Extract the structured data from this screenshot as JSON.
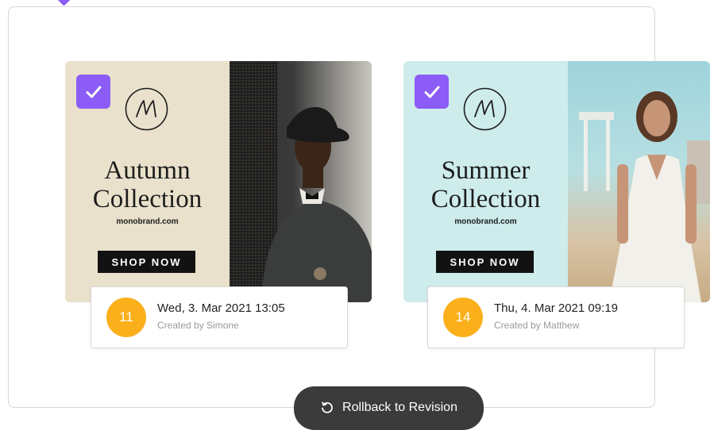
{
  "cards": [
    {
      "selected": true,
      "title_line1": "Autumn",
      "title_line2": "Collection",
      "domain": "monobrand.com",
      "cta": "SHOP NOW",
      "revision": {
        "number": "11",
        "date": "Wed, 3. Mar 2021 13:05",
        "created_by": "Created by Simone"
      }
    },
    {
      "selected": true,
      "title_line1": "Summer",
      "title_line2": "Collection",
      "domain": "monobrand.com",
      "cta": "SHOP NOW",
      "revision": {
        "number": "14",
        "date": "Thu, 4. Mar 2021 09:19",
        "created_by": "Created by Matthew"
      }
    }
  ],
  "actions": {
    "rollback_label": "Rollback to Revision"
  },
  "colors": {
    "accent": "#8b5cf6",
    "badge": "#fbb01b",
    "button_dark": "#3b3b3b",
    "autumn_panel": "#e9e1cb",
    "summer_panel": "#cdeceb"
  },
  "icons": {
    "check": "check-icon",
    "logo": "monobrand-logo-icon",
    "rollback": "rollback-icon"
  }
}
